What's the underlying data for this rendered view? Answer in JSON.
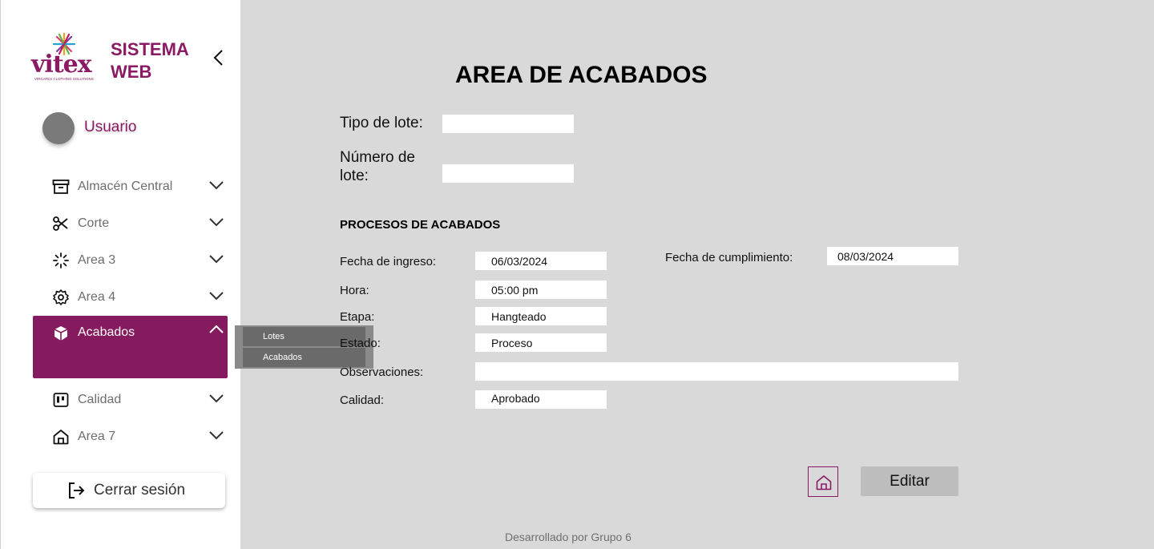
{
  "sidebar": {
    "logo": {
      "word": "vitex",
      "sub": "VIRCATEX CLOTHING SOLUTIONS"
    },
    "brand_title": "SISTEMA WEB",
    "user_name": "Usuario",
    "items": [
      {
        "label": "Almacén Central",
        "icon": "archive-box-icon"
      },
      {
        "label": "Corte",
        "icon": "scissors-icon"
      },
      {
        "label": "Area 3",
        "icon": "loader-icon"
      },
      {
        "label": "Area 4",
        "icon": "gear-icon"
      },
      {
        "label": "Acabados",
        "icon": "cube-icon"
      },
      {
        "label": "Calidad",
        "icon": "kanban-icon"
      },
      {
        "label": "Area 7",
        "icon": "home-icon"
      }
    ],
    "logout_label": "Cerrar sesión"
  },
  "submenu": {
    "items": [
      "Lotes",
      "Acabados"
    ]
  },
  "main": {
    "title": "AREA DE ACABADOS",
    "tipo_lote_label": "Tipo de lote:",
    "tipo_lote_value": "",
    "numero_lote_label_1": "Número de",
    "numero_lote_label_2": "lote:",
    "numero_lote_value": "",
    "section_title": "PROCESOS DE ACABADOS",
    "fecha_ingreso_label": "Fecha de ingreso:",
    "fecha_ingreso_value": "06/03/2024",
    "fecha_cumplimiento_label": "Fecha de cumplimiento:",
    "fecha_cumplimiento_value": "08/03/2024",
    "hora_label": "Hora:",
    "hora_value": "05:00 pm",
    "etapa_label": "Etapa:",
    "etapa_value": "Hangteado",
    "estado_label": "Estado:",
    "estado_value": "Proceso",
    "observaciones_label": "Observaciones:",
    "observaciones_value": "",
    "calidad_label": "Calidad:",
    "calidad_value": "Aprobado",
    "edit_label": "Editar"
  },
  "footer": "Desarrollado por Grupo 6",
  "colors": {
    "brand": "#8a1a63",
    "active_bg": "#861a5f",
    "page_bg": "#d9d9d9"
  }
}
